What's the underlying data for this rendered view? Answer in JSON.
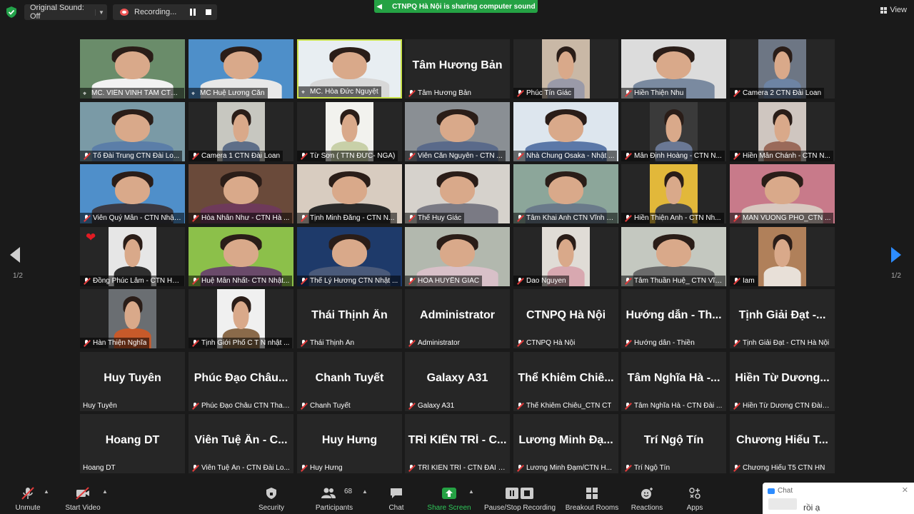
{
  "topbar": {
    "original_sound_label": "Original Sound: Off",
    "recording_label": "Recording...",
    "share_banner": "CTNPQ Hà Nội is sharing computer sound",
    "view_label": "View"
  },
  "pagination": {
    "left": "1/2",
    "right": "1/2"
  },
  "tiles": [
    {
      "name": "MC. VIÊN VINH TÂM CTN...",
      "video": true,
      "pinned": true,
      "bg": "#6a8c6a",
      "shirt": "#f2f2f2"
    },
    {
      "name": "MC Huệ Lương Căn",
      "video": true,
      "pinned": true,
      "bg": "#4e8fc9",
      "shirt": "#e8e8e8"
    },
    {
      "name": "MC. Hòa Đức Nguyệt",
      "video": true,
      "pinned": true,
      "bg": "#e8eef2",
      "shirt": "#d8d8d8",
      "active": true
    },
    {
      "name": "Tâm Hương Bản",
      "video": false,
      "big": "Tâm Hương Bản"
    },
    {
      "name": "Phúc Tín Giác",
      "video": true,
      "bg": "#c9b8a6",
      "shirt": "#9a9aa8",
      "narrow": true
    },
    {
      "name": "Hiền Thiện Nhu",
      "video": true,
      "bg": "#dcdcdc",
      "shirt": "#7a8aa0"
    },
    {
      "name": "Camera 2 CTN Đài Loan",
      "video": true,
      "bg": "#6d7684",
      "shirt": "#6d84a4",
      "narrow": true
    },
    {
      "name": "Tổ Đài Trung  CTN Đài Lo...",
      "video": true,
      "bg": "#7a9aa6",
      "shirt": "#5b7ea8"
    },
    {
      "name": "Camera 1 CTN Đài Loan",
      "video": true,
      "bg": "#c7c7c0",
      "shirt": "#5e6e88",
      "narrow": true
    },
    {
      "name": "Từ Sơn ( TTN ĐỨC- NGA)",
      "video": true,
      "bg": "#f2f2ee",
      "shirt": "#c8d0a8",
      "narrow": true
    },
    {
      "name": "Viên Căn Nguyên - CTN ...",
      "video": true,
      "bg": "#8a8f94",
      "shirt": "#5a6a8a"
    },
    {
      "name": "Nhà Chung Osaka - Nhật ...",
      "video": true,
      "bg": "#dde6ee",
      "shirt": "#5b78a8"
    },
    {
      "name": "Mẫn Định Hoàng - CTN N...",
      "video": true,
      "bg": "#3a3a3a",
      "shirt": "#6a7894",
      "narrow": true
    },
    {
      "name": "Hiền Mẫn Chánh - CTN N...",
      "video": true,
      "bg": "#cfc6c0",
      "shirt": "#9a6a5a",
      "narrow": true
    },
    {
      "name": "Viên Quý Mẫn - CTN Nhật...",
      "video": true,
      "bg": "#4f8fca",
      "shirt": "#3a3a44"
    },
    {
      "name": "Hòa Nhẫn Như - CTN Hà ...",
      "video": true,
      "bg": "#6a4a3a",
      "shirt": "#6e3a5a"
    },
    {
      "name": "Tịnh Minh Đăng - CTN N...",
      "video": true,
      "bg": "#d8ccc0",
      "shirt": "#2a2a2a"
    },
    {
      "name": "Thể Huy Giác",
      "video": true,
      "bg": "#d6d2cc",
      "shirt": "#7a7a84"
    },
    {
      "name": "Tâm Khai Anh CTN Vĩnh P...",
      "video": true,
      "bg": "#8ca69a",
      "shirt": "#6a7a8a"
    },
    {
      "name": "Hiền Thiện Anh - CTN Nh...",
      "video": true,
      "bg": "#e2b83a",
      "shirt": "#4a4a4a",
      "narrow": true
    },
    {
      "name": "MAN VUONG PHO_CTN ...",
      "video": true,
      "bg": "#c87a8a",
      "shirt": "#d8c8c0"
    },
    {
      "name": "Đồng Phúc Lâm - CTN Hà...",
      "video": true,
      "bg": "#e6e6e6",
      "shirt": "#2f2f2f",
      "narrow": true,
      "heart": true
    },
    {
      "name": "Huệ Mẫn Nhất- CTN Nhật...",
      "video": true,
      "bg": "#8cc04a",
      "shirt": "#6a4a6a"
    },
    {
      "name": "Thể Lý Hương CTN Nhật ...",
      "video": true,
      "bg": "#1e3a6a",
      "shirt": "#4a5a7a"
    },
    {
      "name": "HÒA HUYỀN GIÁC",
      "video": true,
      "bg": "#b2b8ae",
      "shirt": "#d8c0c8"
    },
    {
      "name": "Dao Nguyen",
      "video": true,
      "bg": "#e0dcd6",
      "shirt": "#d8a8b0",
      "narrow": true
    },
    {
      "name": "Tâm Thuần Huệ_ CTN Vĩn...",
      "video": true,
      "bg": "#c4c8c0",
      "shirt": "#6a6a6a"
    },
    {
      "name": "Iam",
      "video": true,
      "bg": "#b0805a",
      "shirt": "#e8e0d8",
      "narrow": true
    },
    {
      "name": "Hàn Thiện Nghĩa",
      "video": true,
      "bg": "#6a6e72",
      "shirt": "#c85a2a",
      "narrow": true
    },
    {
      "name": "Tịnh Giới Phổ C T N nhật ...",
      "video": true,
      "bg": "#f0f0f0",
      "shirt": "#8a6a4a",
      "narrow": true
    },
    {
      "name": "Thái Thịnh Ân",
      "video": false,
      "big": "Thái Thịnh Ân"
    },
    {
      "name": "Administrator",
      "video": false,
      "big": "Administrator"
    },
    {
      "name": "CTNPQ Hà Nội",
      "video": false,
      "big": "CTNPQ Hà Nội"
    },
    {
      "name": "Hướng dẫn - Thiền",
      "video": false,
      "big": "Hướng dẫn - Th..."
    },
    {
      "name": "Tịnh Giải Đạt - CTN Hà Nội",
      "video": false,
      "big": "Tịnh Giải Đạt -..."
    },
    {
      "name": "Huy Tuyên",
      "video": false,
      "big": "Huy Tuyên",
      "nomic": true
    },
    {
      "name": "Phúc Đạo Châu CTN Than...",
      "video": false,
      "big": "Phúc Đạo Châu..."
    },
    {
      "name": "Chanh Tuyết",
      "video": false,
      "big": "Chanh Tuyết"
    },
    {
      "name": "Galaxy A31",
      "video": false,
      "big": "Galaxy A31"
    },
    {
      "name": "Thể Khiêm Chiêu_CTN CT",
      "video": false,
      "big": "Thể Khiêm Chiê..."
    },
    {
      "name": "Tâm Nghĩa Hà - CTN Đài ...",
      "video": false,
      "big": "Tâm Nghĩa Hà -..."
    },
    {
      "name": "Hiền Từ Dương CTN Đài L...",
      "video": false,
      "big": "Hiền Từ Dương..."
    },
    {
      "name": "Hoang  DT",
      "video": false,
      "big": "Hoang  DT",
      "nomic": true
    },
    {
      "name": "Viên Tuệ Ân - CTN Đài Lo...",
      "video": false,
      "big": "Viên Tuệ Ân - C..."
    },
    {
      "name": "Huy Hưng",
      "video": false,
      "big": "Huy Hưng"
    },
    {
      "name": "TRÍ KIÊN TRÍ - CTN ĐÀI L...",
      "video": false,
      "big": "TRÍ KIÊN TRÍ - C..."
    },
    {
      "name": "Lương Minh Đạm/CTN H...",
      "video": false,
      "big": "Lương Minh Đạ..."
    },
    {
      "name": "Trí Ngộ Tín",
      "video": false,
      "big": "Trí Ngộ Tín"
    },
    {
      "name": "Chương Hiếu T5 CTN HN",
      "video": false,
      "big": "Chương Hiếu T..."
    }
  ],
  "toolbar": {
    "unmute": "Unmute",
    "start_video": "Start Video",
    "security": "Security",
    "participants": "Participants",
    "participants_count": "68",
    "chat": "Chat",
    "share_screen": "Share Screen",
    "pause_stop_recording": "Pause/Stop Recording",
    "breakout_rooms": "Breakout Rooms",
    "reactions": "Reactions",
    "apps": "Apps"
  },
  "chat_popup": {
    "title": "Chat",
    "message": "rồi ạ"
  }
}
